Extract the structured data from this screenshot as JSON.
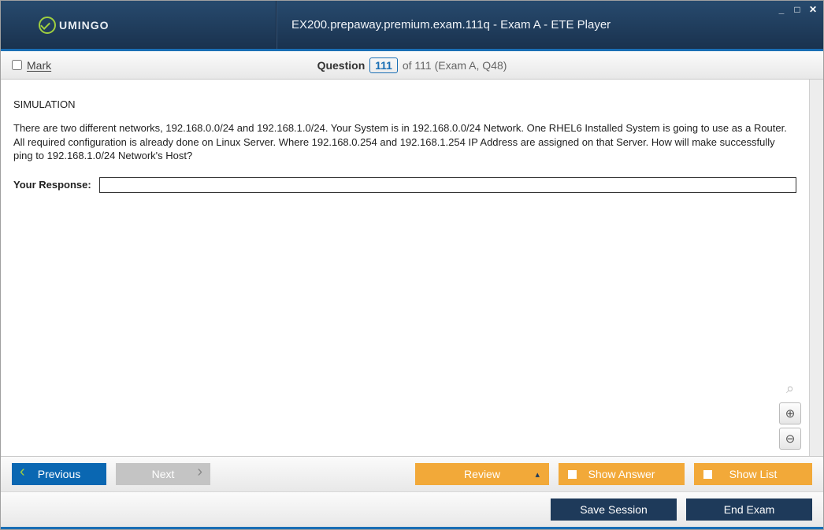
{
  "window": {
    "logo_text": "UMINGO",
    "title": "EX200.prepaway.premium.exam.111q - Exam A - ETE Player"
  },
  "subheader": {
    "mark_label": "Mark",
    "question_word": "Question",
    "question_current": "111",
    "question_total_text": "of 111 (Exam A, Q48)"
  },
  "content": {
    "simulation_label": "SIMULATION",
    "question_text": "There are two different networks, 192.168.0.0/24 and 192.168.1.0/24. Your System is in 192.168.0.0/24 Network. One RHEL6 Installed System is going to use as a Router. All required configuration is already done on Linux Server. Where 192.168.0.254 and 192.168.1.254 IP Address are assigned on that Server. How will make successfully ping to 192.168.1.0/24 Network's Host?",
    "response_label": "Your Response:",
    "response_value": ""
  },
  "buttons": {
    "previous": "Previous",
    "next": "Next",
    "review": "Review",
    "show_answer": "Show Answer",
    "show_list": "Show List",
    "save_session": "Save Session",
    "end_exam": "End Exam"
  },
  "icons": {
    "zoom_reset": "⌕",
    "zoom_in": "⊕",
    "zoom_out": "⊖"
  }
}
